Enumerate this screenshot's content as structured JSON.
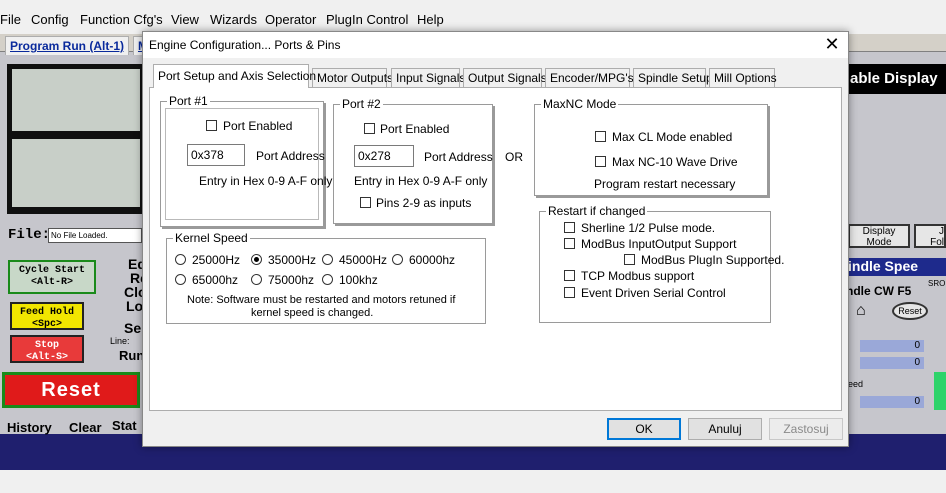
{
  "app": {
    "menu": [
      "File",
      "Config",
      "Function Cfg's",
      "View",
      "Wizards",
      "Operator",
      "PlugIn Control",
      "Help"
    ],
    "tabs": [
      "Program Run (Alt-1)",
      "M"
    ],
    "file_label": "File:",
    "file_value": "No File Loaded.",
    "buttons": {
      "cycle_start": [
        "Cycle Start",
        "<Alt-R>"
      ],
      "feed_hold": [
        "Feed Hold",
        "<Spc>"
      ],
      "stop": [
        "Stop",
        "<Alt-S>"
      ],
      "reset": "Reset"
    },
    "side_labels": [
      "Ed",
      "Re",
      "Clo",
      "Lo",
      "Se",
      "Line:",
      "Run"
    ],
    "bottom": {
      "history": "History",
      "clear": "Clear",
      "stat": "Stat"
    },
    "right": {
      "title": "able Display",
      "display_mode": [
        "Display",
        "Mode"
      ],
      "fo": [
        "J",
        "Fol"
      ],
      "spindle_title": "indle Spee",
      "spindle_cw": "ndle CW F5",
      "sro": "SRO",
      "reset_small": "Reset",
      "dro_values": [
        "0",
        "0",
        "0"
      ],
      "eed": "eed"
    },
    "colors": {
      "bg": "#1f1f6e",
      "reset_red": "#e01a1a",
      "cycle_green": "#1a8a1a",
      "feed_yellow": "#f2e600"
    }
  },
  "dialog": {
    "title": "Engine Configuration... Ports & Pins",
    "close_icon": "close-x-icon",
    "tabs": [
      "Port Setup and Axis Selection",
      "Motor Outputs",
      "Input Signals",
      "Output Signals",
      "Encoder/MPG's",
      "Spindle Setup",
      "Mill Options"
    ],
    "port1": {
      "title": "Port #1",
      "enabled_label": "Port Enabled",
      "enabled": false,
      "address": "0x378",
      "address_label": "Port Address",
      "hint": "Entry in Hex 0-9 A-F only"
    },
    "port2": {
      "title": "Port #2",
      "enabled_label": "Port Enabled",
      "enabled": false,
      "address": "0x278",
      "address_label": "Port Address",
      "hint": "Entry in Hex 0-9 A-F only",
      "pins_label": "Pins 2-9 as inputs",
      "pins_checked": false
    },
    "or_label": "OR",
    "maxnc": {
      "title": "MaxNC Mode",
      "max_cl": "Max CL Mode enabled",
      "max_nc10": "Max NC-10 Wave Drive",
      "restart_note": "Program restart necessary"
    },
    "kernel": {
      "title": "Kernel Speed",
      "options": [
        "25000Hz",
        "35000Hz",
        "45000Hz",
        "60000hz",
        "65000hz",
        "75000hz",
        "100khz"
      ],
      "selected": "35000Hz",
      "note_line1": "Note: Software must be restarted and motors retuned if",
      "note_line2": "kernel speed is changed."
    },
    "restart": {
      "title": "Restart if changed",
      "sherline": "Sherline 1/2 Pulse mode.",
      "modbus_io": "ModBus InputOutput Support",
      "modbus_plugin": "ModBus PlugIn Supported.",
      "tcp_modbus": "TCP Modbus support",
      "event_serial": "Event Driven Serial Control"
    },
    "buttons": {
      "ok": "OK",
      "cancel": "Anuluj",
      "apply": "Zastosuj"
    }
  }
}
